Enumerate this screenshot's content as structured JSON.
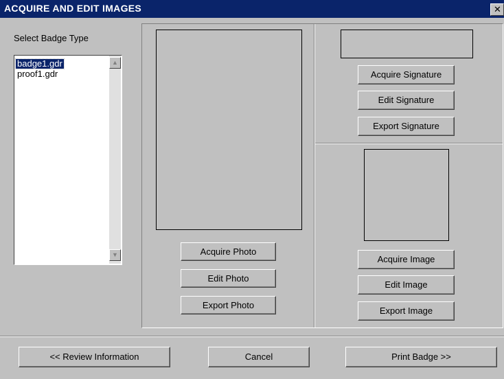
{
  "window": {
    "title": "ACQUIRE AND EDIT IMAGES",
    "close_glyph": "✕"
  },
  "badge": {
    "label": "Select Badge Type",
    "items": [
      "badge1.gdr",
      "proof1.gdr"
    ],
    "selected": "badge1.gdr",
    "scroll_up": "▲",
    "scroll_down": "▼"
  },
  "photo": {
    "acquire": "Acquire Photo",
    "edit": "Edit Photo",
    "export": "Export Photo"
  },
  "signature": {
    "acquire": "Acquire Signature",
    "edit": "Edit Signature",
    "export": "Export Signature"
  },
  "image": {
    "acquire": "Acquire Image",
    "edit": "Edit Image",
    "export": "Export Image"
  },
  "footer": {
    "review": "<< Review Information",
    "cancel": "Cancel",
    "print": "Print Badge >>"
  }
}
